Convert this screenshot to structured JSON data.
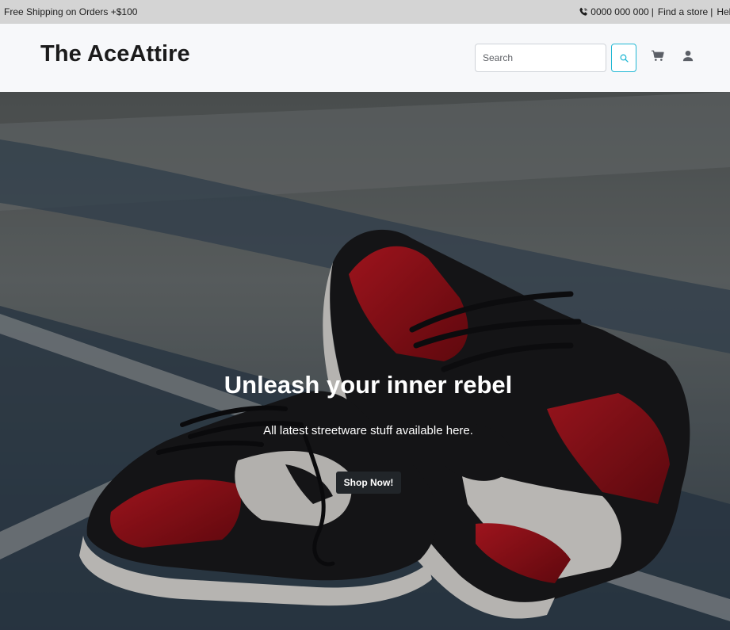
{
  "topbar": {
    "shipping_text": "Free Shipping on Orders +$100",
    "phone": "0000 000 000",
    "separator": "|",
    "find_store": "Find a store",
    "help": "Help"
  },
  "header": {
    "brand": "The AceAttire",
    "search_placeholder": "Search"
  },
  "hero": {
    "title": "Unleash your inner rebel",
    "subtitle": "All latest streetware stuff available here.",
    "cta_label": "Shop Now!"
  },
  "icons": {
    "phone": "phone-icon",
    "search": "search-icon",
    "cart": "cart-icon",
    "user": "user-icon"
  },
  "colors": {
    "topbar_bg": "#d4d4d4",
    "header_bg": "#f7f8fa",
    "search_accent": "#21b8d4",
    "cta_bg": "#212529",
    "sneaker_red": "#b3121c"
  }
}
